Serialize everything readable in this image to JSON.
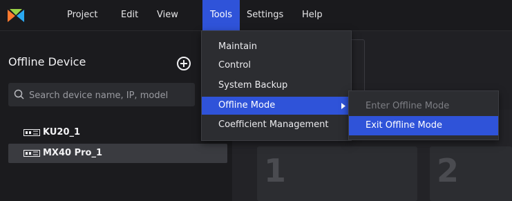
{
  "menubar": {
    "items": [
      {
        "label": "Project"
      },
      {
        "label": "Edit"
      },
      {
        "label": "View"
      },
      {
        "label": "Tools"
      },
      {
        "label": "Settings"
      },
      {
        "label": "Help"
      }
    ],
    "active_index": 3,
    "logo_icon": "app-logo-icon"
  },
  "sidebar": {
    "title": "Offline Device",
    "add_icon": "plus-circle-icon",
    "search": {
      "placeholder": "Search device name, IP, model",
      "value": ""
    },
    "devices": [
      {
        "label": "KU20_1",
        "icon": "device-icon",
        "selected": false
      },
      {
        "label": "MX40 Pro_1",
        "icon": "device-icon",
        "selected": true
      }
    ]
  },
  "main": {
    "screens": [
      {
        "label": "1"
      },
      {
        "label": "2"
      }
    ]
  },
  "tools_menu": {
    "items": [
      {
        "label": "Maintain"
      },
      {
        "label": "Control"
      },
      {
        "label": "System Backup"
      },
      {
        "label": "Offline Mode",
        "has_submenu": true
      },
      {
        "label": "Coefficient Management"
      }
    ],
    "highlighted_index": 3,
    "submenu": {
      "items": [
        {
          "label": "Enter Offline Mode",
          "disabled": true
        },
        {
          "label": "Exit Offline Mode",
          "disabled": false
        }
      ],
      "highlighted_index": 1
    }
  },
  "colors": {
    "accent": "#2f53d9",
    "background": "#1b1b1e",
    "menu_bg": "#2c2d31"
  }
}
